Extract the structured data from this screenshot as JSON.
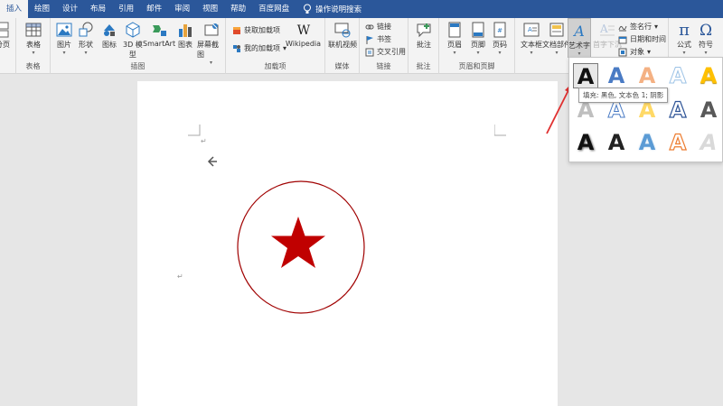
{
  "tabs": [
    "插入",
    "绘图",
    "设计",
    "布局",
    "引用",
    "邮件",
    "审阅",
    "视图",
    "帮助",
    "百度网盘"
  ],
  "search_label": "操作说明搜索",
  "ribbon": {
    "pages": {
      "partial_label": "分页"
    },
    "tables": {
      "btn": "表格",
      "group": "表格"
    },
    "illustrations": {
      "group": "插图",
      "picture": "图片",
      "shapes": "形状",
      "icons": "图标",
      "model3d_1": "3D 模",
      "model3d_2": "型",
      "smartart": "SmartArt",
      "chart": "图表",
      "screenshot": "屏幕截图"
    },
    "addins": {
      "group": "加载项",
      "get": "获取加载项",
      "my": "我的加载项",
      "wiki": "Wikipedia"
    },
    "media": {
      "group": "媒体",
      "video": "联机视频"
    },
    "links": {
      "group": "链接",
      "link": "链接",
      "bookmark": "书签",
      "xref": "交叉引用"
    },
    "comments": {
      "group": "批注",
      "comment": "批注"
    },
    "header_footer": {
      "group": "页眉和页脚",
      "header": "页眉",
      "footer": "页脚",
      "page_number": "页码"
    },
    "text": {
      "textbox": "文本框",
      "quickparts": "文档部件",
      "wordart": "艺术字",
      "dropcap": "首字下沉",
      "signature": "签名行",
      "datetime": "日期和时间",
      "object": "对象"
    },
    "symbols": {
      "equation": "公式",
      "symbol": "符号"
    }
  },
  "tooltip": "填充: 黑色, 文本色 1; 阴影",
  "gallery_letter": "A",
  "colors": {
    "accent": "#2b579a",
    "star": "#c00000",
    "circle": "#c00000",
    "arrow": "#e03030"
  }
}
